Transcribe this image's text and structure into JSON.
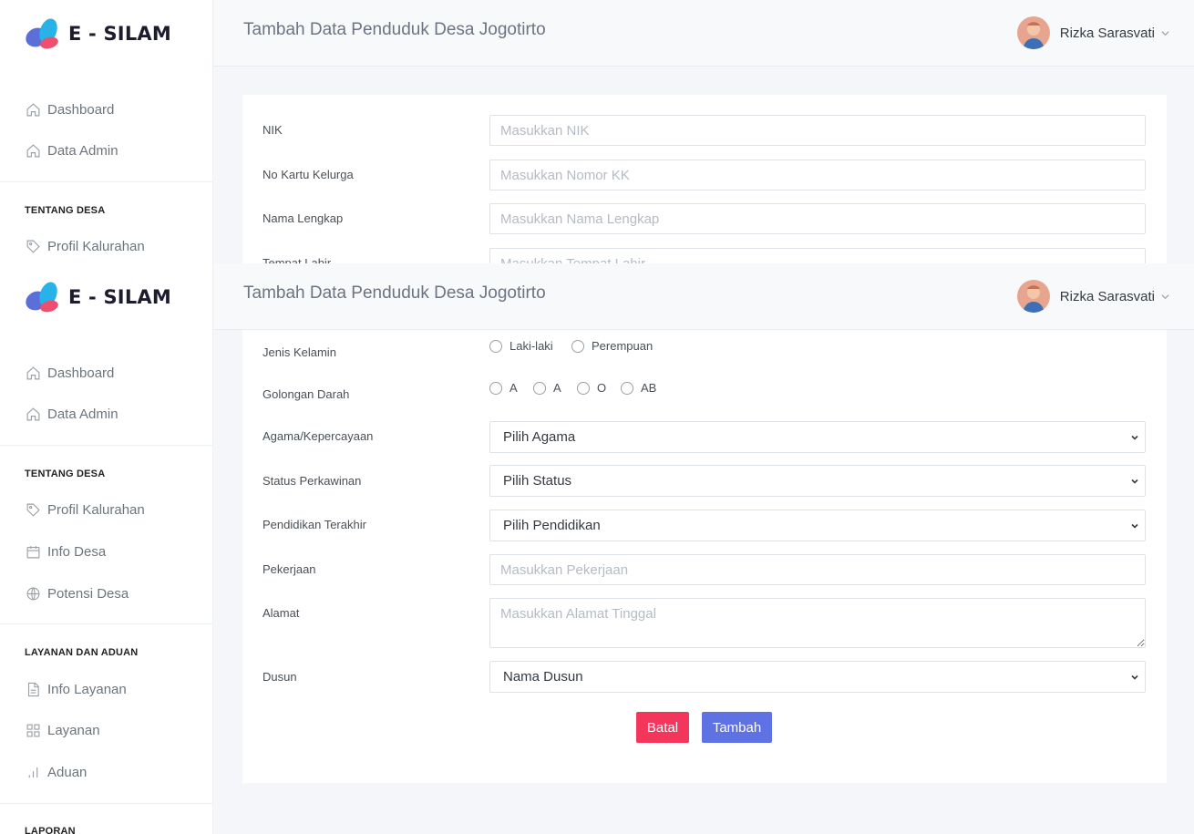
{
  "app": {
    "logo_text": "E - SILAM"
  },
  "header": {
    "title": "Tambah Data Penduduk Desa Jogotirto",
    "user_name": "Rizka Sarasvati"
  },
  "sidebar": {
    "items": [
      {
        "label": "Dashboard",
        "icon": "home-icon"
      },
      {
        "label": "Data Admin",
        "icon": "home-icon"
      }
    ],
    "sections": [
      {
        "title": "TENTANG DESA",
        "items": [
          {
            "label": "Profil Kalurahan",
            "icon": "tag-icon"
          },
          {
            "label": "Info Desa",
            "icon": "calendar-icon"
          },
          {
            "label": "Potensi Desa",
            "icon": "globe-icon"
          }
        ]
      },
      {
        "title": "LAYANAN DAN ADUAN",
        "items": [
          {
            "label": "Info Layanan",
            "icon": "file-icon"
          },
          {
            "label": "Layanan",
            "icon": "grid-icon"
          },
          {
            "label": "Aduan",
            "icon": "bar-chart-icon"
          }
        ]
      },
      {
        "title": "LAPORAN"
      }
    ]
  },
  "form": {
    "nik": {
      "label": "NIK",
      "placeholder": "Masukkan NIK"
    },
    "kk": {
      "label": "No Kartu Kelurga",
      "placeholder": "Masukkan Nomor KK"
    },
    "nama": {
      "label": "Nama Lengkap",
      "placeholder": "Masukkan Nama Lengkap"
    },
    "tempat_lahir": {
      "label": "Tempat Lahir",
      "placeholder": "Masukkan Tempat Lahir"
    },
    "jenis_kelamin": {
      "label": "Jenis Kelamin",
      "options": [
        "Laki-laki",
        "Perempuan"
      ]
    },
    "golongan_darah": {
      "label": "Golongan Darah",
      "options": [
        "A",
        "A",
        "O",
        "AB"
      ]
    },
    "agama": {
      "label": "Agama/Kepercayaan",
      "value": "Pilih Agama"
    },
    "status": {
      "label": "Status Perkawinan",
      "value": "Pilih Status"
    },
    "pendidikan": {
      "label": "Pendidikan Terakhir",
      "value": "Pilih Pendidikan"
    },
    "pekerjaan": {
      "label": "Pekerjaan",
      "placeholder": "Masukkan Pekerjaan"
    },
    "alamat": {
      "label": "Alamat",
      "placeholder": "Masukkan Alamat Tinggal"
    },
    "dusun": {
      "label": "Dusun",
      "value": "Nama Dusun"
    },
    "buttons": {
      "cancel": "Batal",
      "submit": "Tambah"
    }
  },
  "colors": {
    "accent": "#5e72e4",
    "danger": "#f5365c",
    "background": "#f5f6fa"
  }
}
